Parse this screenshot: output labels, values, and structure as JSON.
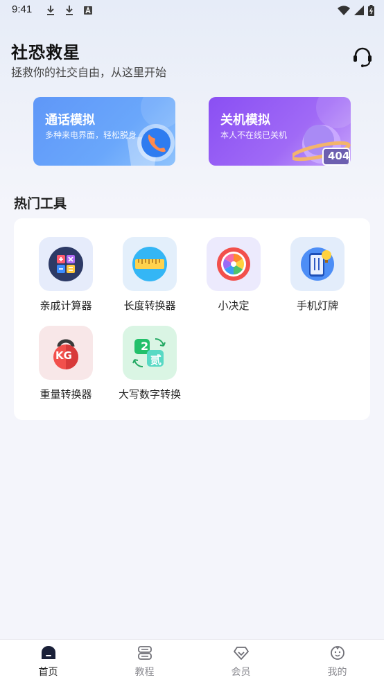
{
  "status_bar": {
    "time": "9:41"
  },
  "header": {
    "title": "社恐救星",
    "subtitle": "拯救你的社交自由，从这里开始"
  },
  "banners": [
    {
      "title": "通话模拟",
      "desc": "多种来电界面，轻松脱身",
      "icon": "phone-icon"
    },
    {
      "title": "关机模拟",
      "desc": "本人不在线已关机",
      "icon": "planet-404-icon",
      "badge": "404"
    }
  ],
  "hot_tools": {
    "title": "热门工具",
    "items": [
      {
        "label": "亲戚计算器",
        "icon": "calculator-icon"
      },
      {
        "label": "长度转换器",
        "icon": "ruler-icon"
      },
      {
        "label": "小决定",
        "icon": "spinner-wheel-icon"
      },
      {
        "label": "手机灯牌",
        "icon": "phone-lightbox-icon"
      },
      {
        "label": "重量转换器",
        "icon": "kettlebell-icon",
        "badge": "KG"
      },
      {
        "label": "大写数字转换",
        "icon": "number-convert-icon",
        "small": "2",
        "big": "贰"
      }
    ]
  },
  "bottom_nav": [
    {
      "label": "首页",
      "icon": "home-icon",
      "active": true
    },
    {
      "label": "教程",
      "icon": "tutorial-icon",
      "active": false
    },
    {
      "label": "会员",
      "icon": "vip-icon",
      "active": false
    },
    {
      "label": "我的",
      "icon": "profile-icon",
      "active": false
    }
  ],
  "colors": {
    "call_banner": "#5f97f8",
    "shutdown_banner": "#8a4ff3",
    "nav_active": "#222222",
    "nav_inactive": "#8a8a90"
  }
}
